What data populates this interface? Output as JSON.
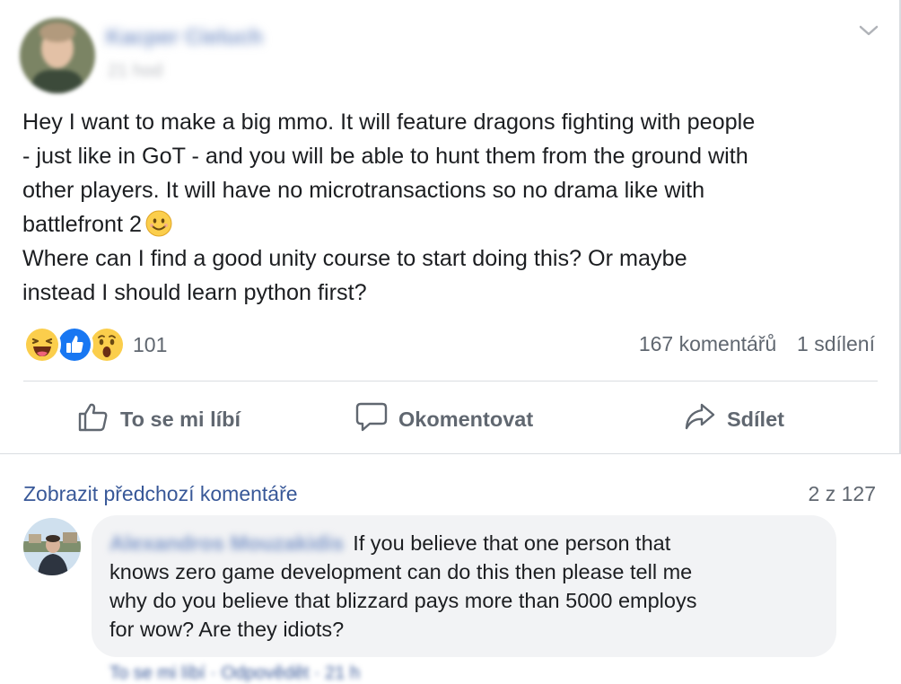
{
  "post": {
    "author_name": "Kacper Cieluch",
    "timestamp": "21 hod",
    "text_lines": [
      "Hey I want to make a big mmo. It will feature dragons fighting with people",
      "- just like in GoT - and you will be able to hunt them from the ground with",
      "other players. It will have no microtransactions so no drama like with",
      "battlefront 2",
      "Where can I find a good unity course to start doing this? Or maybe",
      "instead I should learn python first?"
    ],
    "reactions": {
      "icons": [
        "haha-icon",
        "like-icon",
        "wow-icon"
      ],
      "count": "101"
    },
    "comments_count": "167 komentářů",
    "shares_count": "1 sdílení",
    "actions": {
      "like": "To se mi líbí",
      "comment": "Okomentovat",
      "share": "Sdílet"
    }
  },
  "comments": {
    "show_previous": "Zobrazit předchozí komentáře",
    "count_label": "2 z 127",
    "items": [
      {
        "author": "Alexandros Mouzakidis",
        "text_lines": [
          "If you believe that one person that",
          "knows zero game development can do this then please tell me",
          "why do you believe that blizzard pays more than 5000 employs",
          "for wow? Are they idiots?"
        ],
        "actions": "To se mi líbí · Odpovědět · 21 h"
      }
    ]
  },
  "colors": {
    "link": "#385898",
    "secondary": "#606770",
    "bubble": "#f2f3f5",
    "like_blue": "#1877f2",
    "emoji_yellow": "#fbce4c"
  }
}
